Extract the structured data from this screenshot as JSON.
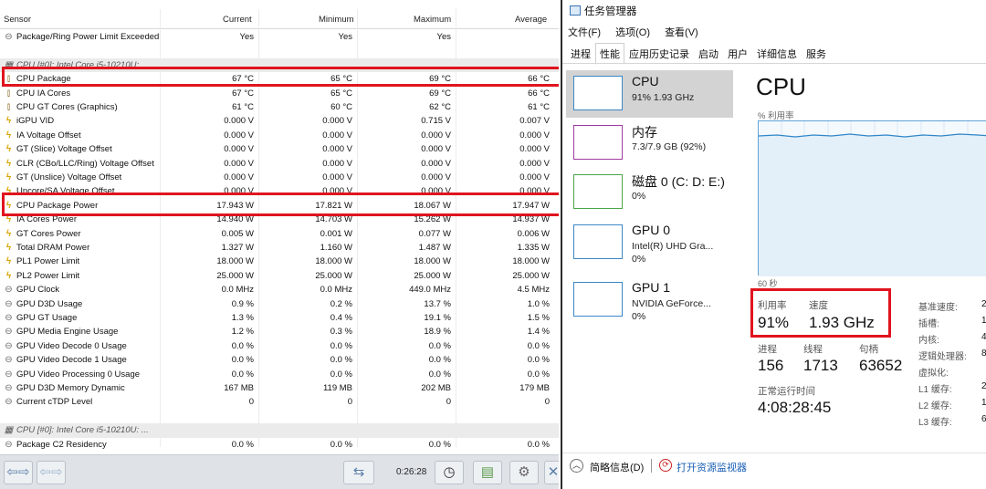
{
  "hwinfo": {
    "columns": [
      "Sensor",
      "Current",
      "Minimum",
      "Maximum",
      "Average"
    ],
    "rows": [
      {
        "icon": "circle-icon",
        "name": "Package/Ring Power Limit Exceeded",
        "cur": "Yes",
        "min": "Yes",
        "max": "Yes",
        "avg": ""
      },
      {
        "icon": "",
        "name": "",
        "cur": "",
        "min": "",
        "max": "",
        "avg": ""
      },
      {
        "icon": "chip-icon",
        "name": "CPU [#0]: Intel Core i5-10210U:",
        "cur": "",
        "min": "",
        "max": "",
        "avg": "",
        "group": true
      },
      {
        "icon": "thermometer-icon",
        "name": "CPU Package",
        "cur": "67 °C",
        "min": "65 °C",
        "max": "69 °C",
        "avg": "66 °C"
      },
      {
        "icon": "thermometer-icon",
        "name": "CPU IA Cores",
        "cur": "67 °C",
        "min": "65 °C",
        "max": "69 °C",
        "avg": "66 °C"
      },
      {
        "icon": "thermometer-icon",
        "name": "CPU GT Cores (Graphics)",
        "cur": "61 °C",
        "min": "60 °C",
        "max": "62 °C",
        "avg": "61 °C"
      },
      {
        "icon": "bolt-icon",
        "name": "iGPU VID",
        "cur": "0.000 V",
        "min": "0.000 V",
        "max": "0.715 V",
        "avg": "0.007 V"
      },
      {
        "icon": "bolt-icon",
        "name": "IA Voltage Offset",
        "cur": "0.000 V",
        "min": "0.000 V",
        "max": "0.000 V",
        "avg": "0.000 V"
      },
      {
        "icon": "bolt-icon",
        "name": "GT (Slice) Voltage Offset",
        "cur": "0.000 V",
        "min": "0.000 V",
        "max": "0.000 V",
        "avg": "0.000 V"
      },
      {
        "icon": "bolt-icon",
        "name": "CLR (CBo/LLC/Ring) Voltage Offset",
        "cur": "0.000 V",
        "min": "0.000 V",
        "max": "0.000 V",
        "avg": "0.000 V"
      },
      {
        "icon": "bolt-icon",
        "name": "GT (Unslice) Voltage Offset",
        "cur": "0.000 V",
        "min": "0.000 V",
        "max": "0.000 V",
        "avg": "0.000 V"
      },
      {
        "icon": "bolt-icon",
        "name": "Uncore/SA Voltage Offset",
        "cur": "0.000 V",
        "min": "0.000 V",
        "max": "0.000 V",
        "avg": "0.000 V"
      },
      {
        "icon": "bolt-icon",
        "name": "CPU Package Power",
        "cur": "17.943 W",
        "min": "17.821 W",
        "max": "18.067 W",
        "avg": "17.947 W"
      },
      {
        "icon": "bolt-icon",
        "name": "IA Cores Power",
        "cur": "14.940 W",
        "min": "14.703 W",
        "max": "15.262 W",
        "avg": "14.937 W"
      },
      {
        "icon": "bolt-icon",
        "name": "GT Cores Power",
        "cur": "0.005 W",
        "min": "0.001 W",
        "max": "0.077 W",
        "avg": "0.006 W"
      },
      {
        "icon": "bolt-icon",
        "name": "Total DRAM Power",
        "cur": "1.327 W",
        "min": "1.160 W",
        "max": "1.487 W",
        "avg": "1.335 W"
      },
      {
        "icon": "bolt-icon",
        "name": "PL1 Power Limit",
        "cur": "18.000 W",
        "min": "18.000 W",
        "max": "18.000 W",
        "avg": "18.000 W"
      },
      {
        "icon": "bolt-icon",
        "name": "PL2 Power Limit",
        "cur": "25.000 W",
        "min": "25.000 W",
        "max": "25.000 W",
        "avg": "25.000 W"
      },
      {
        "icon": "circle-icon",
        "name": "GPU Clock",
        "cur": "0.0 MHz",
        "min": "0.0 MHz",
        "max": "449.0 MHz",
        "avg": "4.5 MHz"
      },
      {
        "icon": "circle-icon",
        "name": "GPU D3D Usage",
        "cur": "0.9 %",
        "min": "0.2 %",
        "max": "13.7 %",
        "avg": "1.0 %"
      },
      {
        "icon": "circle-icon",
        "name": "GPU GT Usage",
        "cur": "1.3 %",
        "min": "0.4 %",
        "max": "19.1 %",
        "avg": "1.5 %"
      },
      {
        "icon": "circle-icon",
        "name": "GPU Media Engine Usage",
        "cur": "1.2 %",
        "min": "0.3 %",
        "max": "18.9 %",
        "avg": "1.4 %"
      },
      {
        "icon": "circle-icon",
        "name": "GPU Video Decode 0 Usage",
        "cur": "0.0 %",
        "min": "0.0 %",
        "max": "0.0 %",
        "avg": "0.0 %"
      },
      {
        "icon": "circle-icon",
        "name": "GPU Video Decode 1 Usage",
        "cur": "0.0 %",
        "min": "0.0 %",
        "max": "0.0 %",
        "avg": "0.0 %"
      },
      {
        "icon": "circle-icon",
        "name": "GPU Video Processing 0 Usage",
        "cur": "0.0 %",
        "min": "0.0 %",
        "max": "0.0 %",
        "avg": "0.0 %"
      },
      {
        "icon": "circle-icon",
        "name": "GPU D3D Memory Dynamic",
        "cur": "167 MB",
        "min": "119 MB",
        "max": "202 MB",
        "avg": "179 MB"
      },
      {
        "icon": "circle-icon",
        "name": "Current cTDP Level",
        "cur": "0",
        "min": "0",
        "max": "0",
        "avg": "0"
      },
      {
        "icon": "",
        "name": "",
        "cur": "",
        "min": "",
        "max": "",
        "avg": ""
      },
      {
        "icon": "chip-icon",
        "name": "CPU [#0]: Intel Core i5-10210U: ...",
        "cur": "",
        "min": "",
        "max": "",
        "avg": "",
        "group": true
      },
      {
        "icon": "circle-icon",
        "name": "Package C2 Residency",
        "cur": "0.0 %",
        "min": "0.0 %",
        "max": "0.0 %",
        "avg": "0.0 %"
      }
    ],
    "timer": "0:26:28"
  },
  "taskmgr": {
    "title": "任务管理器",
    "menu": [
      "文件(F)",
      "选项(O)",
      "查看(V)"
    ],
    "tabs": [
      "进程",
      "性能",
      "应用历史记录",
      "启动",
      "用户",
      "详细信息",
      "服务"
    ],
    "active_tab": 1,
    "sidebar": [
      {
        "name": "CPU",
        "sub1": "91% 1.93 GHz",
        "sub2": "",
        "color": "#3b87c6",
        "selected": true
      },
      {
        "name": "内存",
        "sub1": "7.3/7.9 GB (92%)",
        "sub2": "",
        "color": "#a23aa0",
        "selected": false
      },
      {
        "name": "磁盘 0 (C: D: E:)",
        "sub1": "0%",
        "sub2": "",
        "color": "#4aa64a",
        "selected": false
      },
      {
        "name": "GPU 0",
        "sub1": "Intel(R) UHD Gra...",
        "sub2": "0%",
        "color": "#3b87c6",
        "selected": false
      },
      {
        "name": "GPU 1",
        "sub1": "NVIDIA GeForce...",
        "sub2": "0%",
        "color": "#3b87c6",
        "selected": false
      }
    ],
    "heading": "CPU",
    "util_label": "% 利用率",
    "seconds_label": "60 秒",
    "stats": {
      "util_label": "利用率",
      "util": "91%",
      "speed_label": "速度",
      "speed": "1.93 GHz",
      "proc_label": "进程",
      "proc": "156",
      "thread_label": "线程",
      "thread": "1713",
      "handle_label": "句柄",
      "handle": "63652",
      "uptime_label": "正常运行时间",
      "uptime": "4:08:28:45"
    },
    "right_labels": [
      "基准速度:",
      "插槽:",
      "内核:",
      "逻辑处理器:",
      "虚拟化:",
      "L1 缓存:",
      "L2 缓存:",
      "L3 缓存:"
    ],
    "right_values": [
      "2",
      "1",
      "4",
      "8",
      "",
      "2",
      "1",
      "6"
    ],
    "footer": {
      "brief": "简略信息(D)",
      "monitor": "打开资源监视器"
    }
  }
}
